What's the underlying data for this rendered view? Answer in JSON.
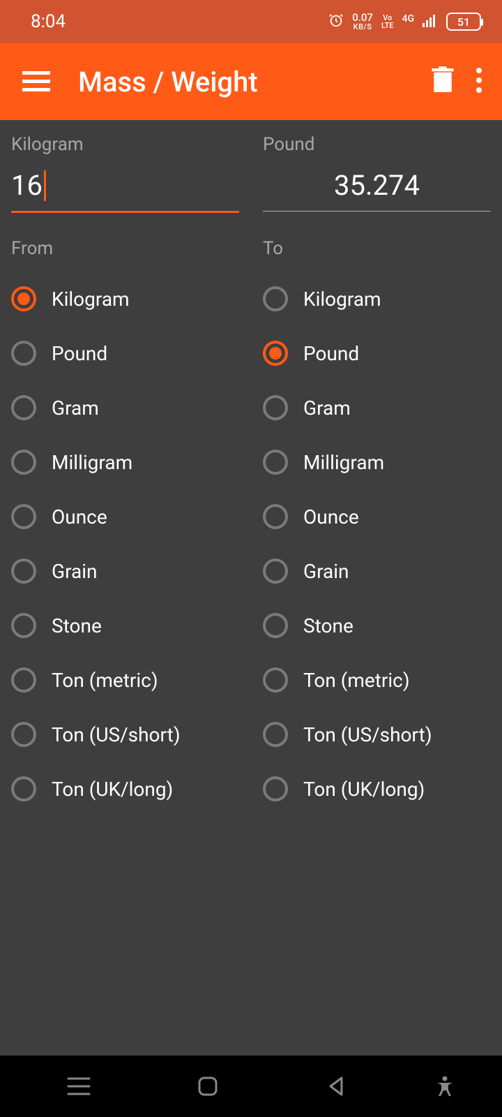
{
  "status": {
    "time": "8:04",
    "speed_top": "0.07",
    "speed_bot": "KB/S",
    "volte_top": "Vo",
    "volte_bot": "LTE",
    "network": "4G",
    "battery": "51"
  },
  "header": {
    "title": "Mass / Weight"
  },
  "input": {
    "from_label": "Kilogram",
    "from_value": "16",
    "to_label": "Pound",
    "to_value": "35.274"
  },
  "sections": {
    "from": "From",
    "to": "To"
  },
  "units": [
    "Kilogram",
    "Pound",
    "Gram",
    "Milligram",
    "Ounce",
    "Grain",
    "Stone",
    "Ton (metric)",
    "Ton (US/short)",
    "Ton (UK/long)"
  ],
  "selection": {
    "from": "Kilogram",
    "to": "Pound"
  }
}
